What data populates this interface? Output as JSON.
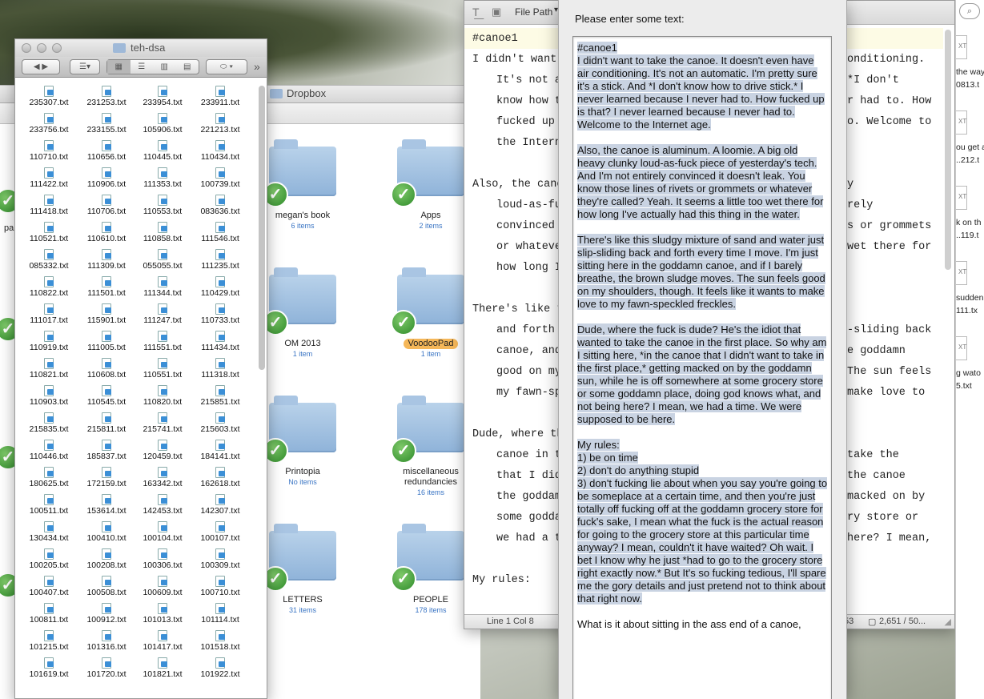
{
  "dropbox": {
    "title": "Dropbox",
    "folders": [
      {
        "name": "megan's book",
        "count": "6 items",
        "tagged": false
      },
      {
        "name": "Apps",
        "count": "2 items",
        "tagged": false
      },
      {
        "name": "OM 2013",
        "count": "1 item",
        "tagged": false
      },
      {
        "name": "VoodooPad",
        "count": "1 item",
        "tagged": true
      },
      {
        "name": "Printopia",
        "count": "No items",
        "tagged": false
      },
      {
        "name": "miscellaneous redundancies",
        "count": "16 items",
        "tagged": false
      },
      {
        "name": "LETTERS",
        "count": "31 items",
        "tagged": false
      },
      {
        "name": "PEOPLE",
        "count": "178 items",
        "tagged": false
      }
    ],
    "partial_label": "pa"
  },
  "finder": {
    "title": "teh-dsa",
    "files": [
      "235307.txt",
      "231253.txt",
      "233954.txt",
      "233911.txt",
      "233756.txt",
      "233155.txt",
      "105906.txt",
      "221213.txt",
      "110710.txt",
      "110656.txt",
      "110445.txt",
      "110434.txt",
      "111422.txt",
      "110906.txt",
      "111353.txt",
      "100739.txt",
      "111418.txt",
      "110706.txt",
      "110553.txt",
      "083636.txt",
      "110521.txt",
      "110610.txt",
      "110858.txt",
      "111546.txt",
      "085332.txt",
      "111309.txt",
      "055055.txt",
      "111235.txt",
      "110822.txt",
      "111501.txt",
      "111344.txt",
      "110429.txt",
      "111017.txt",
      "115901.txt",
      "111247.txt",
      "110733.txt",
      "110919.txt",
      "111005.txt",
      "111551.txt",
      "111434.txt",
      "110821.txt",
      "110608.txt",
      "110551.txt",
      "111318.txt",
      "110903.txt",
      "110545.txt",
      "110820.txt",
      "215851.txt",
      "215835.txt",
      "215811.txt",
      "215741.txt",
      "215603.txt",
      "110446.txt",
      "185837.txt",
      "120459.txt",
      "184141.txt",
      "180625.txt",
      "172159.txt",
      "163342.txt",
      "162618.txt",
      "100511.txt",
      "153614.txt",
      "142453.txt",
      "142307.txt",
      "130434.txt",
      "100410.txt",
      "100104.txt",
      "100107.txt",
      "100205.txt",
      "100208.txt",
      "100306.txt",
      "100309.txt",
      "100407.txt",
      "100508.txt",
      "100609.txt",
      "100710.txt",
      "100811.txt",
      "100912.txt",
      "101013.txt",
      "101114.txt",
      "101215.txt",
      "101316.txt",
      "101417.txt",
      "101518.txt",
      "101619.txt",
      "101720.txt",
      "101821.txt",
      "101922.txt"
    ]
  },
  "editor": {
    "toolbar_label": "File Path",
    "lines": [
      "#canoe1",
      "I didn't want",
      "It's not a",
      "know how t",
      "fucked up",
      "the Intern",
      "",
      "Also, the cano",
      "loud-as-fu",
      "convinced",
      "or whateve",
      "how long I",
      "",
      "There's like t",
      "and forth",
      "canoe, and",
      "good on my",
      "my fawn-sp",
      "",
      "Dude, where th",
      "canoe in t",
      "that I did",
      "the goddam",
      "some godda",
      "we had a t",
      "",
      "My rules:"
    ],
    "right_lines": [
      "onditioning.",
      "*I don't",
      "r had to. How",
      "o. Welcome to",
      "",
      "",
      "y",
      "rely",
      "s or grommets",
      "wet there for",
      "",
      "",
      "",
      "-sliding back",
      "e goddamn",
      "The sun feels",
      "make love to",
      "",
      "",
      "take the",
      "the canoe",
      "macked on by",
      "ry store or",
      "here? I mean,",
      "",
      "",
      ""
    ],
    "status_position": "Line 1 Col 8",
    "status_words": "53",
    "status_chars": "2,651 / 50..."
  },
  "dialog": {
    "prompt": "Please enter some text:",
    "paragraphs": [
      "#canoe1\nI didn't want to take the canoe. It doesn't even have air conditioning. It's not an automatic. I'm pretty sure it's a stick. And *I don't know how to drive stick.* I never learned because I never had to. How fucked up is that? I never learned because I never had to. Welcome to the Internet age.",
      "Also, the canoe is aluminum. A loomie. A big old heavy clunky loud-as-fuck piece of yesterday's tech. And I'm not entirely convinced it doesn't leak. You know those lines of rivets or grommets or whatever they're called? Yeah. It seems a little too wet there for how long I've actually had this thing in the water.",
      "There's like this sludgy mixture of sand and water just slip-sliding back and forth every time I move. I'm just sitting here in the goddamn canoe, and if I barely breathe, the brown sludge moves. The sun feels good on my shoulders, though. It feels like it wants to make love to my fawn-speckled freckles.",
      "Dude, where the fuck is dude? He's the idiot that wanted to take the canoe in the first place. So why am I sitting here, *in the canoe that I didn't want to take in the first place,* getting macked on by the goddamn sun, while he is off somewhere at some grocery store or some goddamn place, doing god knows what, and not being here? I mean, we had a time. We were supposed to be here.",
      "My rules:\n1) be on time\n2) don't do anything stupid\n3) don't fucking lie about when you say you're going to be someplace at a certain time, and then you're just totally off fucking off at the goddamn grocery store for fuck's sake, I mean what the fuck is the actual reason for going to the grocery store at this particular time anyway? I mean, couldn't it have waited? Oh wait. I bet I know why he just *had to go to the grocery store right exactly now.* But It's so fucking tedious, I'll spare me the gory details and just pretend not to think about that right now.",
      "What is it about sitting in the ass end of a canoe,"
    ]
  },
  "right_strip": {
    "files": [
      "the way",
      "0813.t",
      "ou get a",
      "..212.t",
      "k on th",
      "..119.t",
      "sudden",
      "111.tx",
      "g wato",
      "5.txt"
    ]
  }
}
